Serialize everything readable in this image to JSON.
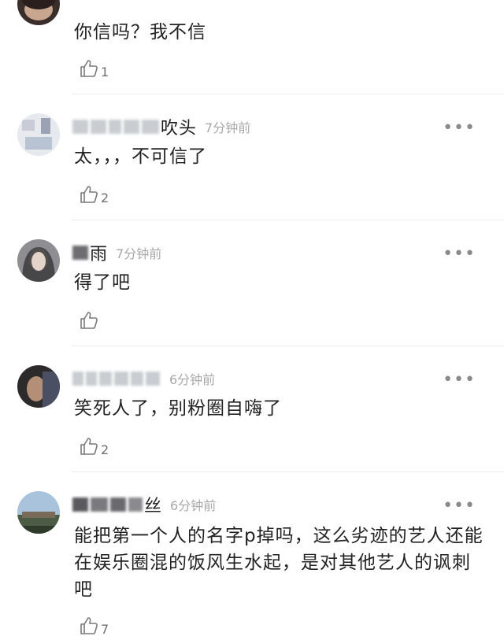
{
  "comments": [
    {
      "name": "",
      "time": "",
      "text": "你信吗？我不信",
      "likes": "1"
    },
    {
      "name": "吹头",
      "time": "7分钟前",
      "text": "太，，，不可信了",
      "likes": "2"
    },
    {
      "name": "雨",
      "time": "7分钟前",
      "text": "得了吧",
      "likes": ""
    },
    {
      "name": "",
      "time": "6分钟前",
      "text": "笑死人了，别粉圈自嗨了",
      "likes": "2"
    },
    {
      "name": "丝",
      "time": "6分钟前",
      "text": "能把第一个人的名字p掉吗，这么劣迹的艺人还能在娱乐圈混的饭风生水起，是对其他艺人的讽刺吧",
      "likes": "7"
    }
  ],
  "more_label": "•••",
  "icons": {
    "like": "thumbs-up-icon",
    "more": "more-dots-icon"
  },
  "colors": {
    "divider": "#ececec",
    "time": "#a8a8a8",
    "text": "#222222"
  }
}
